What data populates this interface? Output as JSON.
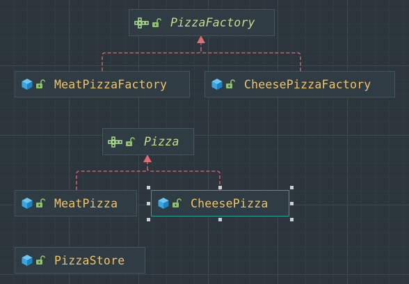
{
  "diagram": {
    "nodes": [
      {
        "id": "pizza-factory",
        "label": "PizzaFactory",
        "kind": "interface"
      },
      {
        "id": "meat-pizza-factory",
        "label": "MeatPizzaFactory",
        "kind": "class"
      },
      {
        "id": "cheese-pizza-factory",
        "label": "CheesePizzaFactory",
        "kind": "class"
      },
      {
        "id": "pizza",
        "label": "Pizza",
        "kind": "interface"
      },
      {
        "id": "meat-pizza",
        "label": "MeatPizza",
        "kind": "class"
      },
      {
        "id": "cheese-pizza",
        "label": "CheesePizza",
        "kind": "class",
        "selected": true
      },
      {
        "id": "pizza-store",
        "label": "PizzaStore",
        "kind": "class"
      }
    ],
    "edges": [
      {
        "from": "meat-pizza-factory",
        "to": "pizza-factory",
        "type": "implements"
      },
      {
        "from": "cheese-pizza-factory",
        "to": "pizza-factory",
        "type": "implements"
      },
      {
        "from": "meat-pizza",
        "to": "pizza",
        "type": "implements"
      },
      {
        "from": "cheese-pizza",
        "to": "pizza",
        "type": "implements"
      }
    ]
  },
  "colors": {
    "class_name": "#f0c469",
    "interface_name": "#c8dc8a",
    "edge": "#e06c75",
    "selection": "#27a39a",
    "class_icon": "#3aa7e0",
    "interface_icon": "#a6d88a",
    "lock_icon": "#8fc46b"
  },
  "icons": {
    "class": "cube-icon",
    "interface": "interface-icon",
    "visibility": "unlock-icon"
  }
}
